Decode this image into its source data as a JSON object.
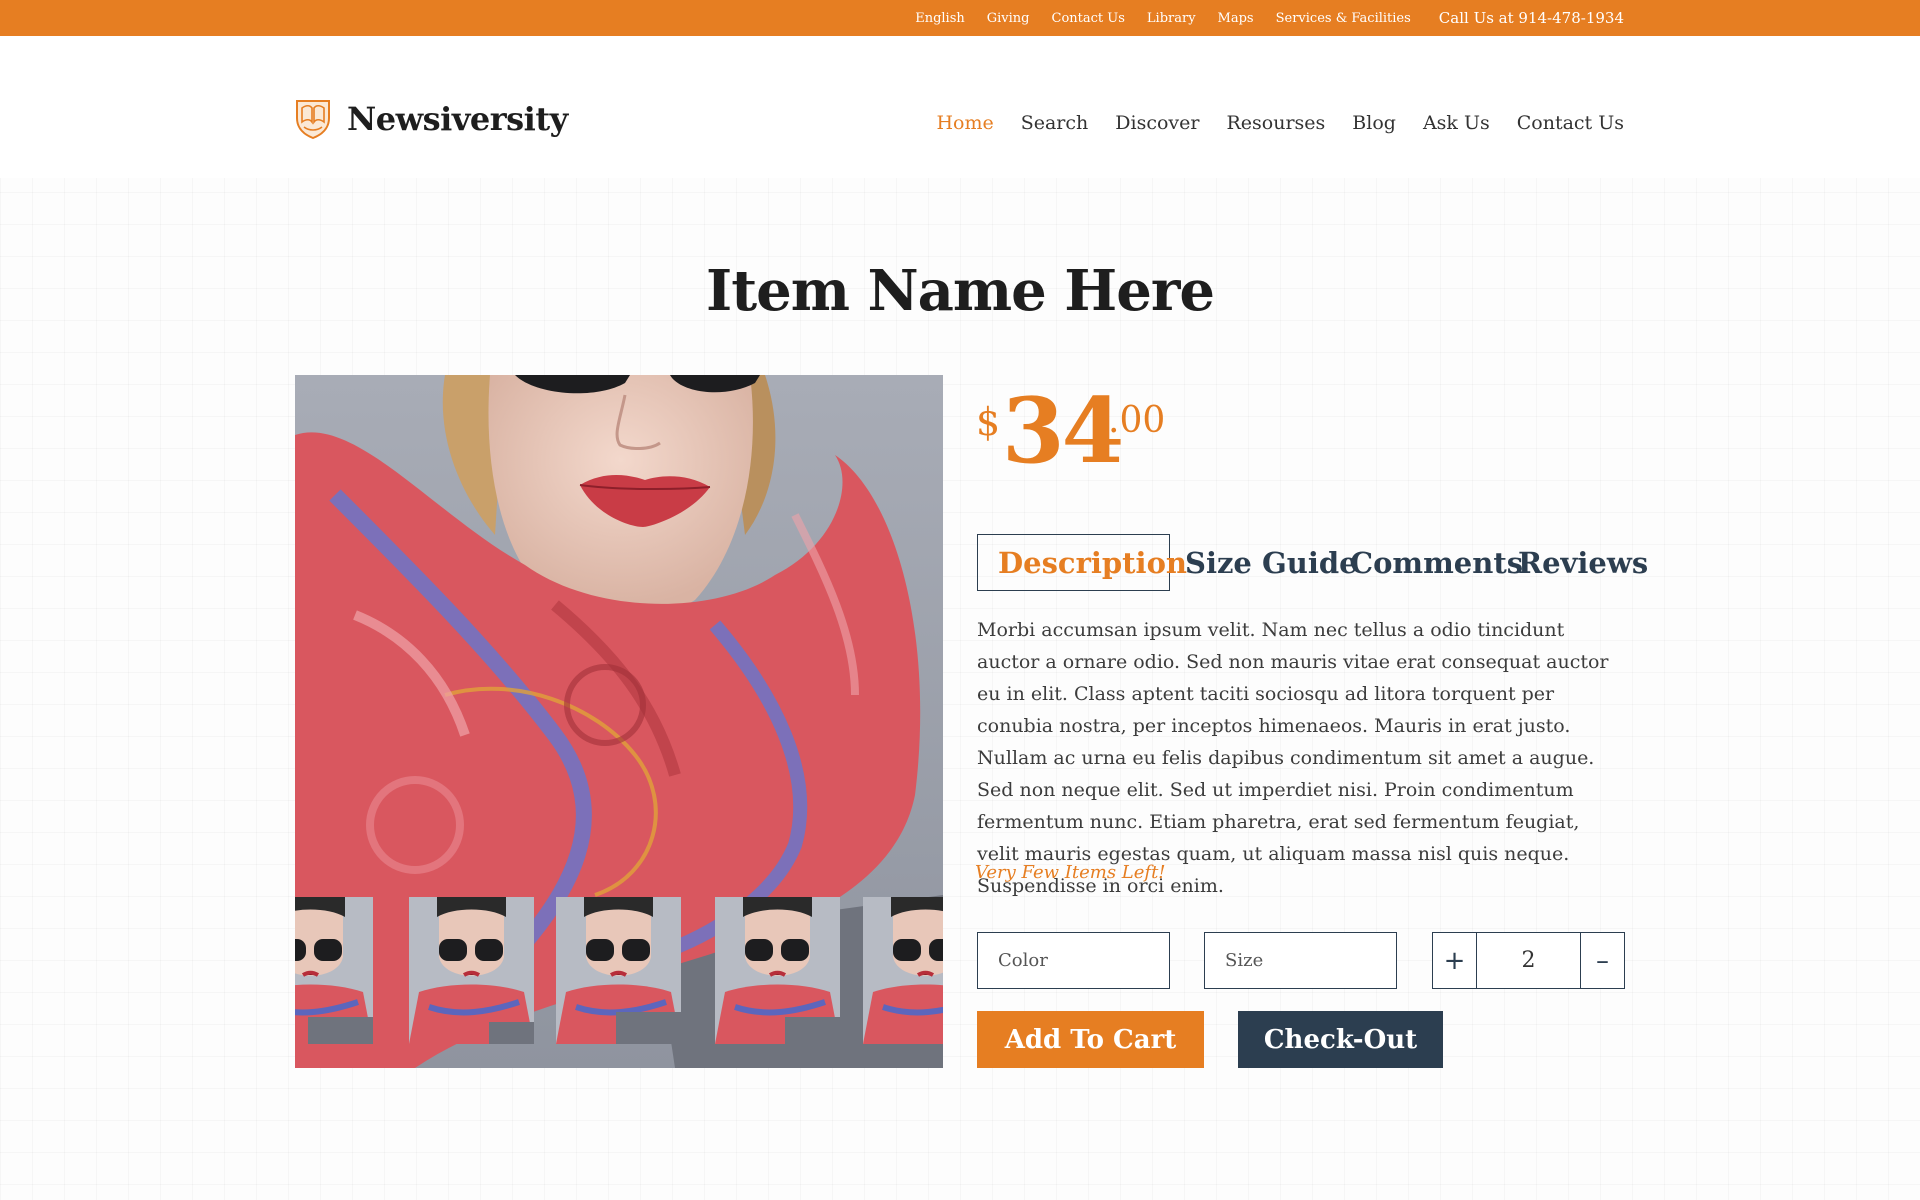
{
  "topbar": {
    "links": [
      "English",
      "Giving",
      "Contact Us",
      "Library",
      "Maps",
      "Services & Facilities"
    ],
    "call": "Call Us at 914-478-1934"
  },
  "header": {
    "logo_icon": "shield-crest-icon",
    "brand": "Newsiversity",
    "nav": [
      "Home",
      "Search",
      "Discover",
      "Resourses",
      "Blog",
      "Ask Us",
      "Contact Us"
    ],
    "active_nav": "Home"
  },
  "page_title": "Item Name Here",
  "price": {
    "currency": "$",
    "integer": "34",
    "decimal": ".00"
  },
  "tabs": [
    "Description",
    "Size Guide",
    "Comments",
    "Reviews"
  ],
  "active_tab": "Description",
  "description": "Morbi accumsan ipsum velit. Nam nec tellus a odio tincidunt auctor a ornare odio. Sed non  mauris vitae erat consequat auctor eu in elit. Class aptent taciti sociosqu ad litora torquent per conubia nostra, per inceptos himenaeos. Mauris in erat justo. Nullam ac urna eu felis dapibus condimentum sit amet a augue. Sed non neque elit. Sed ut imperdiet nisi. Proin condimentum fermentum nunc. Etiam pharetra, erat sed fermentum feugiat, velit mauris egestas quam, ut aliquam massa nisl quis neque. Suspendisse in orci enim.",
  "stock_note": "Very Few Items Left!",
  "options": {
    "color_placeholder": "Color",
    "size_placeholder": "Size",
    "quantity": "2",
    "plus": "+",
    "minus": "–"
  },
  "buttons": {
    "add_to_cart": "Add To Cart",
    "checkout": "Check-Out"
  },
  "colors": {
    "accent": "#e67e22",
    "dark": "#2c3e50"
  }
}
